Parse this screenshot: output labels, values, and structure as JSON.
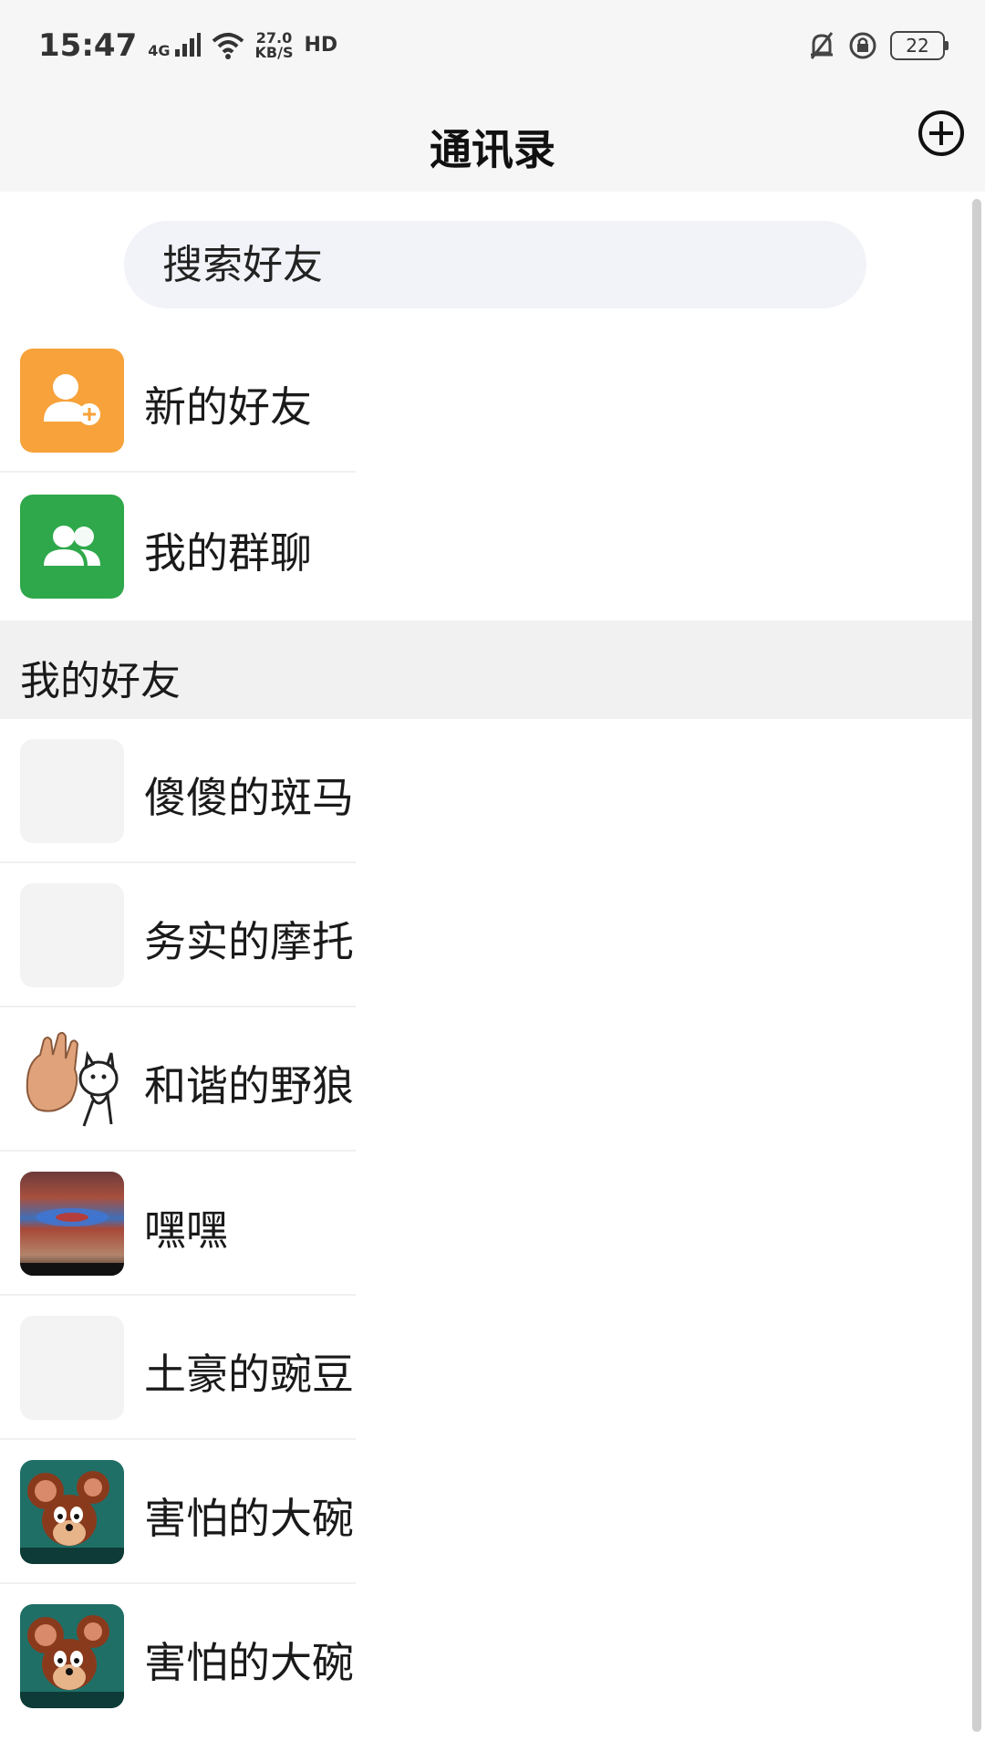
{
  "status_bar": {
    "time": "15:47",
    "network": "4G",
    "speed_value": "27.0",
    "speed_unit": "KB/S",
    "hd": "HD",
    "battery": "22"
  },
  "nav": {
    "title": "通讯录",
    "add_icon": "plus-circle-icon"
  },
  "search": {
    "placeholder": "搜索好友"
  },
  "quick_actions": [
    {
      "label": "新的好友",
      "icon": "add-user-icon",
      "color": "#F7A23A"
    },
    {
      "label": "我的群聊",
      "icon": "group-icon",
      "color": "#2EA84A"
    }
  ],
  "section": {
    "title": "我的好友"
  },
  "friends": [
    {
      "name": "傻傻的斑马",
      "avatar": "blank"
    },
    {
      "name": "务实的摩托",
      "avatar": "blank"
    },
    {
      "name": "和谐的野狼",
      "avatar": "hand-cat-sticker"
    },
    {
      "name": "嘿嘿",
      "avatar": "photo-red-blue"
    },
    {
      "name": "土豪的豌豆",
      "avatar": "blank"
    },
    {
      "name": "害怕的大碗",
      "avatar": "cartoon-mouse"
    },
    {
      "name": "害怕的大碗",
      "avatar": "cartoon-mouse"
    }
  ]
}
